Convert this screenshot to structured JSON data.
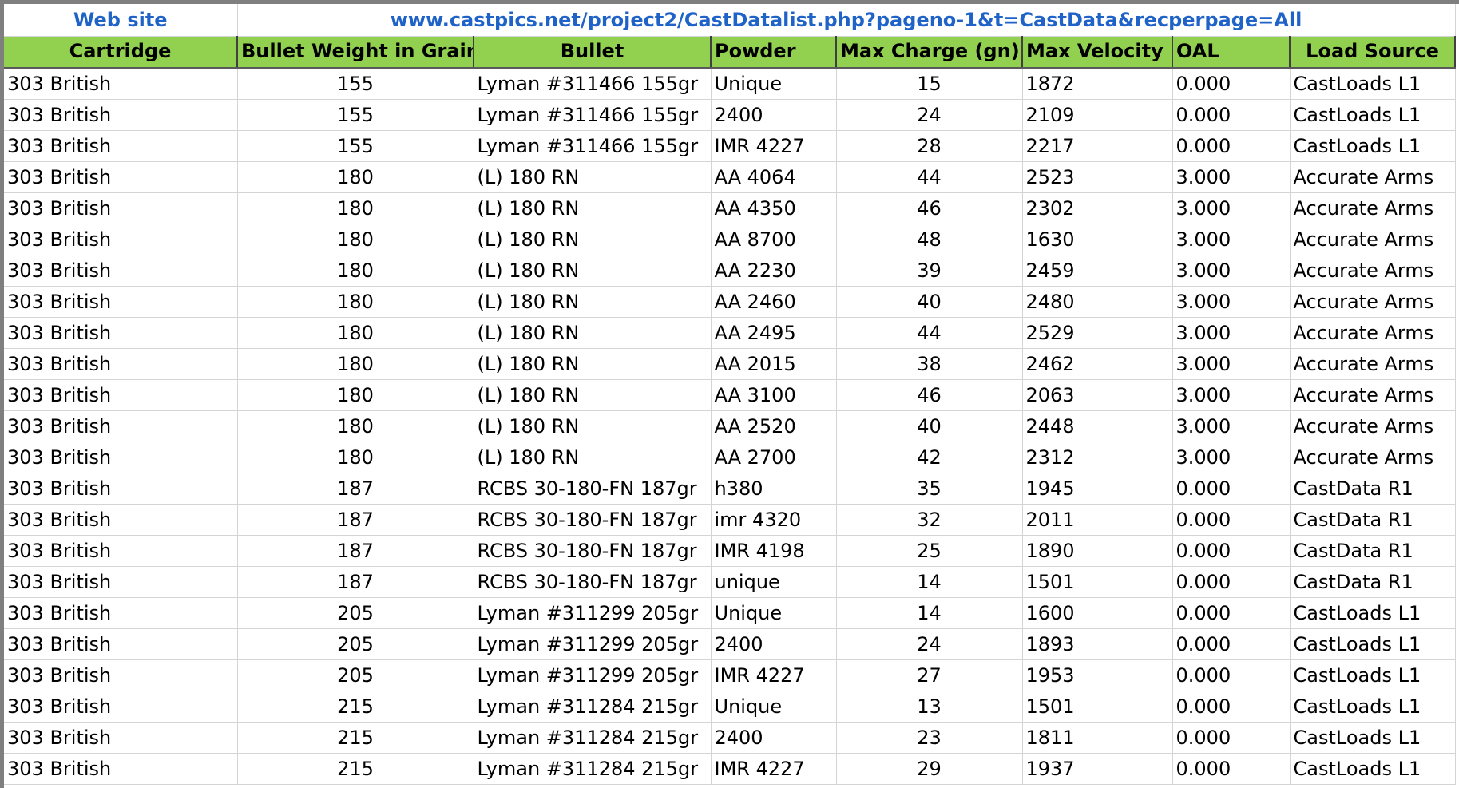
{
  "sheet": {
    "site_label": "Web site",
    "site_url": "www.castpics.net/project2/CastDatalist.php?pageno-1&t=CastData&recperpage=All"
  },
  "table": {
    "columns": [
      "Cartridge",
      "Bullet Weight in Grains",
      "Bullet",
      "Powder",
      "Max Charge (gn)",
      "Max Velocity",
      "OAL",
      "Load Source"
    ],
    "rows": [
      [
        "303 British",
        "155",
        "Lyman #311466 155gr",
        "Unique",
        "15",
        "1872",
        "0.000",
        "CastLoads L1"
      ],
      [
        "303 British",
        "155",
        "Lyman #311466 155gr",
        "2400",
        "24",
        "2109",
        "0.000",
        "CastLoads L1"
      ],
      [
        "303 British",
        "155",
        "Lyman #311466 155gr",
        "IMR 4227",
        "28",
        "2217",
        "0.000",
        "CastLoads L1"
      ],
      [
        "303 British",
        "180",
        "(L) 180 RN",
        "AA 4064",
        "44",
        "2523",
        "3.000",
        "Accurate Arms"
      ],
      [
        "303 British",
        "180",
        "(L) 180 RN",
        "AA 4350",
        "46",
        "2302",
        "3.000",
        "Accurate Arms"
      ],
      [
        "303 British",
        "180",
        "(L) 180 RN",
        "AA 8700",
        "48",
        "1630",
        "3.000",
        "Accurate Arms"
      ],
      [
        "303 British",
        "180",
        "(L) 180 RN",
        "AA 2230",
        "39",
        "2459",
        "3.000",
        "Accurate Arms"
      ],
      [
        "303 British",
        "180",
        "(L) 180 RN",
        "AA 2460",
        "40",
        "2480",
        "3.000",
        "Accurate Arms"
      ],
      [
        "303 British",
        "180",
        "(L) 180 RN",
        "AA 2495",
        "44",
        "2529",
        "3.000",
        "Accurate Arms"
      ],
      [
        "303 British",
        "180",
        "(L) 180 RN",
        "AA 2015",
        "38",
        "2462",
        "3.000",
        "Accurate Arms"
      ],
      [
        "303 British",
        "180",
        "(L) 180 RN",
        "AA 3100",
        "46",
        "2063",
        "3.000",
        "Accurate Arms"
      ],
      [
        "303 British",
        "180",
        "(L) 180 RN",
        "AA 2520",
        "40",
        "2448",
        "3.000",
        "Accurate Arms"
      ],
      [
        "303 British",
        "180",
        "(L) 180 RN",
        "AA 2700",
        "42",
        "2312",
        "3.000",
        "Accurate Arms"
      ],
      [
        "303 British",
        "187",
        "RCBS 30-180-FN 187gr",
        "h380",
        "35",
        "1945",
        "0.000",
        "CastData R1"
      ],
      [
        "303 British",
        "187",
        "RCBS 30-180-FN 187gr",
        "imr 4320",
        "32",
        "2011",
        "0.000",
        "CastData R1"
      ],
      [
        "303 British",
        "187",
        "RCBS 30-180-FN 187gr",
        "IMR 4198",
        "25",
        "1890",
        "0.000",
        "CastData R1"
      ],
      [
        "303 British",
        "187",
        "RCBS 30-180-FN 187gr",
        "unique",
        "14",
        "1501",
        "0.000",
        "CastData R1"
      ],
      [
        "303 British",
        "205",
        "Lyman #311299 205gr",
        "Unique",
        "14",
        "1600",
        "0.000",
        "CastLoads L1"
      ],
      [
        "303 British",
        "205",
        "Lyman #311299 205gr",
        "2400",
        "24",
        "1893",
        "0.000",
        "CastLoads L1"
      ],
      [
        "303 British",
        "205",
        "Lyman #311299 205gr",
        "IMR 4227",
        "27",
        "1953",
        "0.000",
        "CastLoads L1"
      ],
      [
        "303 British",
        "215",
        "Lyman #311284 215gr",
        "Unique",
        "13",
        "1501",
        "0.000",
        "CastLoads L1"
      ],
      [
        "303 British",
        "215",
        "Lyman #311284 215gr",
        "2400",
        "23",
        "1811",
        "0.000",
        "CastLoads L1"
      ],
      [
        "303 British",
        "215",
        "Lyman #311284 215gr",
        "IMR 4227",
        "29",
        "1937",
        "0.000",
        "CastLoads L1"
      ]
    ]
  },
  "colors": {
    "header_fill": "#92d050",
    "link_blue": "#1f62c8",
    "gridline": "#d4d4d4"
  }
}
